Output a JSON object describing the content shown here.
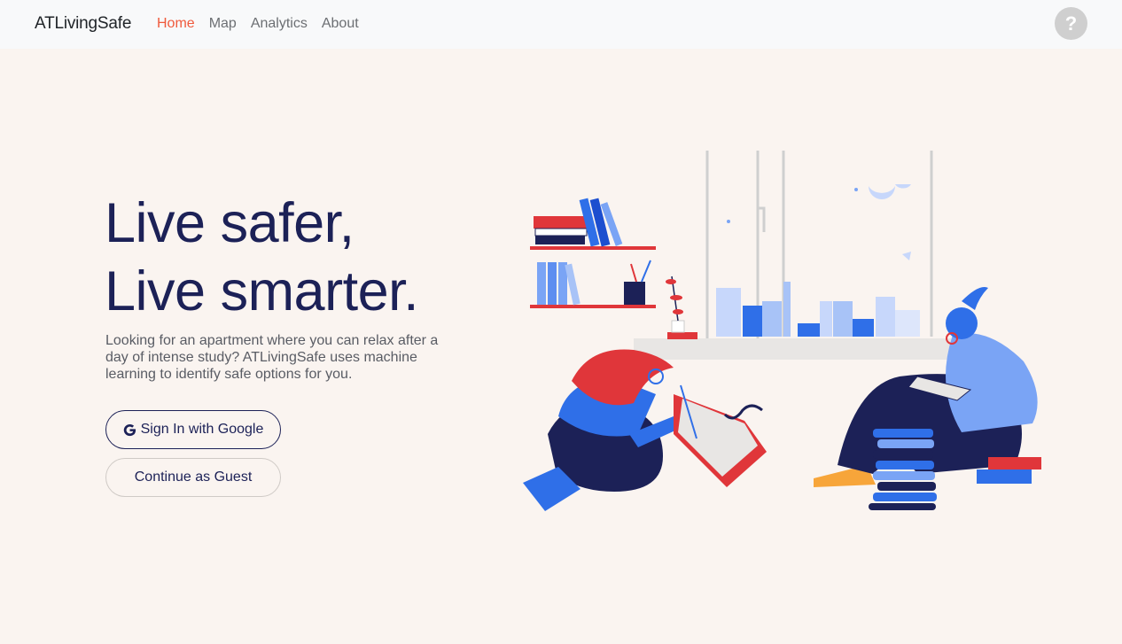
{
  "nav": {
    "brand": "ATLivingSafe",
    "links": [
      {
        "label": "Home",
        "active": true
      },
      {
        "label": "Map",
        "active": false
      },
      {
        "label": "Analytics",
        "active": false
      },
      {
        "label": "About",
        "active": false
      }
    ],
    "help_label": "?"
  },
  "hero": {
    "headline_line1": "Live safer,",
    "headline_line2": "Live smarter.",
    "description": "Looking for an apartment where you can relax after a day of intense study? ATLivingSafe uses machine learning to identify safe options for you.",
    "google_button": "Sign In with Google",
    "guest_button": "Continue as Guest"
  },
  "colors": {
    "background": "#faf4f0",
    "navbar": "#f8f9fa",
    "accent": "#ef5a3c",
    "headline": "#1c2157",
    "illustration_blue": "#2f6fe8",
    "illustration_red": "#e0363a",
    "illustration_navy": "#1c2157"
  },
  "icons": {
    "help": "question-circle-icon",
    "google": "google-g-icon"
  }
}
